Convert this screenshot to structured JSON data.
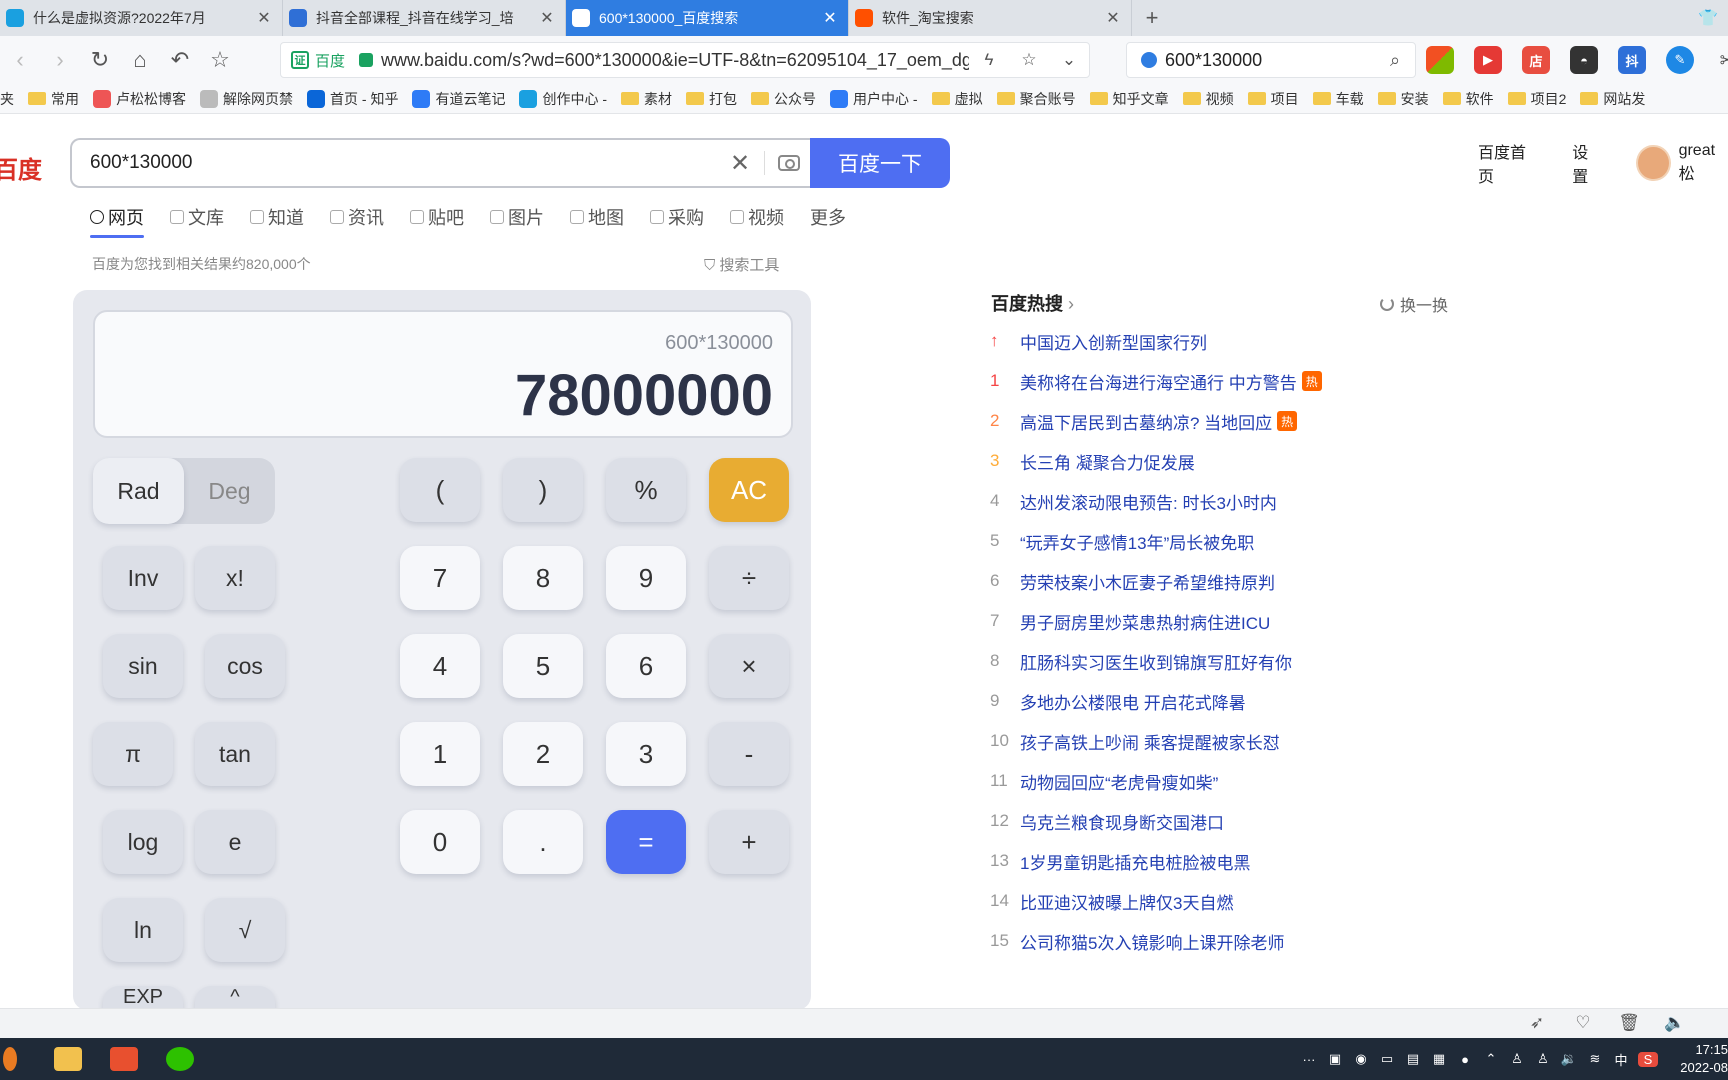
{
  "tabs": [
    {
      "label": "什么是虚拟资源?2022年7月",
      "color": "#1aa0e0",
      "glyph": "tv"
    },
    {
      "label": "抖音全部课程_抖音在线学习_培",
      "color": "#2f6fd6",
      "glyph": "◆"
    },
    {
      "label": "600*130000_百度搜索",
      "color": "#fff",
      "glyph": "du"
    },
    {
      "label": "软件_淘宝搜索",
      "color": "#ff5000",
      "glyph": "淘"
    }
  ],
  "address": {
    "cert_label": "百度",
    "url": "www.baidu.com/s?wd=600*130000&ie=UTF-8&tn=62095104_17_oem_dg",
    "side_search": "600*130000"
  },
  "bookmarks": [
    {
      "label": "夹",
      "type": "none"
    },
    {
      "label": "常用",
      "type": "folder"
    },
    {
      "label": "卢松松博客",
      "type": "fav",
      "color": "#e55"
    },
    {
      "label": "解除网页禁",
      "type": "fav",
      "color": "#bbb"
    },
    {
      "label": "首页 - 知乎",
      "type": "fav",
      "color": "#0a66d8"
    },
    {
      "label": "有道云笔记",
      "type": "fav",
      "color": "#2e7bf6"
    },
    {
      "label": "创作中心 -",
      "type": "fav",
      "color": "#1aa0e0"
    },
    {
      "label": "素材",
      "type": "folder"
    },
    {
      "label": "打包",
      "type": "folder"
    },
    {
      "label": "公众号",
      "type": "folder"
    },
    {
      "label": "用户中心 -",
      "type": "fav",
      "color": "#2e7bf6"
    },
    {
      "label": "虚拟",
      "type": "folder"
    },
    {
      "label": "聚合账号",
      "type": "folder"
    },
    {
      "label": "知乎文章",
      "type": "folder"
    },
    {
      "label": "视频",
      "type": "folder"
    },
    {
      "label": "项目",
      "type": "folder"
    },
    {
      "label": "车载",
      "type": "folder"
    },
    {
      "label": "安装",
      "type": "folder"
    },
    {
      "label": "软件",
      "type": "folder"
    },
    {
      "label": "项目2",
      "type": "folder"
    },
    {
      "label": "网站发",
      "type": "folder"
    }
  ],
  "baidu": {
    "logo": "百度",
    "query": "600*130000",
    "search_button": "百度一下",
    "home_link": "百度首页",
    "settings_link": "设置",
    "username": "great松",
    "nav_tabs": [
      "网页",
      "文库",
      "知道",
      "资讯",
      "贴吧",
      "图片",
      "地图",
      "采购",
      "视频",
      "更多"
    ],
    "result_count": "百度为您找到相关结果约820,000个",
    "search_tools": "搜索工具"
  },
  "calculator": {
    "expression": "600*130000",
    "result": "78000000",
    "rad": "Rad",
    "deg": "Deg",
    "keys": {
      "lparen": "(",
      "rparen": ")",
      "percent": "%",
      "ac": "AC",
      "inv": "Inv",
      "fact": "x!",
      "seven": "7",
      "eight": "8",
      "nine": "9",
      "divide": "÷",
      "sin": "sin",
      "cos": "cos",
      "four": "4",
      "five": "5",
      "six": "6",
      "multiply": "×",
      "pi": "π",
      "tan": "tan",
      "one": "1",
      "two": "2",
      "three": "3",
      "minus": "-",
      "log": "log",
      "e": "e",
      "zero": "0",
      "dot": ".",
      "equals": "=",
      "plus": "+",
      "ln": "ln",
      "sqrt": "√",
      "exp": "EXP",
      "pow": "^"
    }
  },
  "hot": {
    "title": "百度热搜",
    "refresh": "换一换",
    "items": [
      {
        "rank": "",
        "text": "中国迈入创新型国家行列",
        "badge": ""
      },
      {
        "rank": "1",
        "text": "美称将在台海进行海空通行 中方警告",
        "badge": "热"
      },
      {
        "rank": "2",
        "text": "高温下居民到古墓纳凉? 当地回应",
        "badge": "热"
      },
      {
        "rank": "3",
        "text": "长三角 凝聚合力促发展",
        "badge": ""
      },
      {
        "rank": "4",
        "text": "达州发滚动限电预告: 时长3小时内",
        "badge": ""
      },
      {
        "rank": "5",
        "text": "“玩弄女子感情13年”局长被免职",
        "badge": ""
      },
      {
        "rank": "6",
        "text": "劳荣枝案小木匠妻子希望维持原判",
        "badge": ""
      },
      {
        "rank": "7",
        "text": "男子厨房里炒菜患热射病住进ICU",
        "badge": ""
      },
      {
        "rank": "8",
        "text": "肛肠科实习医生收到锦旗写肛好有你",
        "badge": ""
      },
      {
        "rank": "9",
        "text": "多地办公楼限电 开启花式降暑",
        "badge": ""
      },
      {
        "rank": "10",
        "text": "孩子高铁上吵闹 乘客提醒被家长怼",
        "badge": ""
      },
      {
        "rank": "11",
        "text": "动物园回应“老虎骨瘦如柴”",
        "badge": ""
      },
      {
        "rank": "12",
        "text": "乌克兰粮食现身断交国港口",
        "badge": ""
      },
      {
        "rank": "13",
        "text": "1岁男童钥匙插充电桩脸被电黑",
        "badge": ""
      },
      {
        "rank": "14",
        "text": "比亚迪汉被曝上牌仅3天自燃",
        "badge": ""
      },
      {
        "rank": "15",
        "text": "公司称猫5次入镜影响上课开除老师",
        "badge": ""
      }
    ]
  },
  "taskbar": {
    "ime": "中",
    "time": "17:15",
    "date": "2022-08"
  }
}
